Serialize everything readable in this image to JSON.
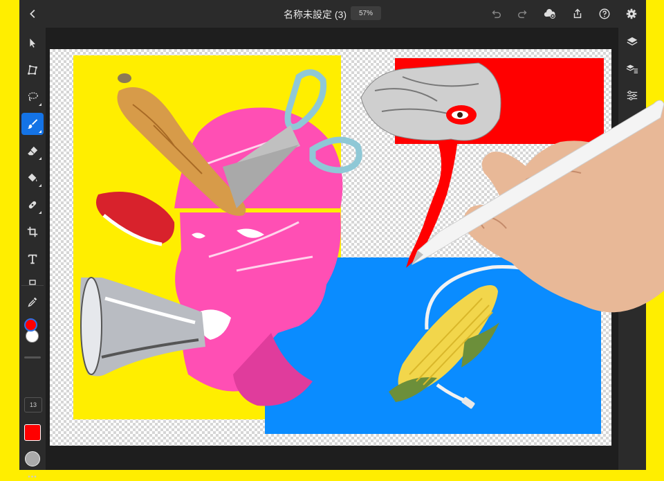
{
  "document": {
    "title": "名称未設定 (3)",
    "zoom": "57%"
  },
  "toolbar": {
    "brush_size": "13",
    "more_label": "•••"
  },
  "colors": {
    "frame_background": "#ffee00",
    "app_background": "#1e1e1e",
    "panel_background": "#2b2b2b",
    "active_tool": "#1473e6",
    "foreground_color": "#ff0000",
    "background_color": "#ffffff",
    "fill_swatch": "#ff0000",
    "collage_yellow": "#ffee00",
    "collage_red": "#ff0000",
    "collage_blue": "#0a8cff",
    "collage_pink": "#ff4fb4"
  },
  "left_tools": [
    {
      "icon": "select-arrow-icon"
    },
    {
      "icon": "transform-icon"
    },
    {
      "icon": "lasso-icon"
    },
    {
      "icon": "brush-icon",
      "active": true
    },
    {
      "icon": "eraser-icon"
    },
    {
      "icon": "fill-bucket-icon"
    },
    {
      "icon": "healing-bandage-icon"
    },
    {
      "icon": "crop-icon"
    },
    {
      "icon": "type-icon"
    },
    {
      "icon": "eyedropper-icon"
    }
  ],
  "right_tools": [
    {
      "icon": "layers-icon"
    },
    {
      "icon": "layer-properties-icon"
    },
    {
      "icon": "adjustments-icon"
    }
  ],
  "top_actions": [
    {
      "icon": "back-chevron-icon"
    },
    {
      "icon": "undo-icon"
    },
    {
      "icon": "redo-icon"
    },
    {
      "icon": "cloud-sync-error-icon"
    },
    {
      "icon": "share-export-icon"
    },
    {
      "icon": "help-icon"
    },
    {
      "icon": "settings-gear-icon"
    }
  ]
}
